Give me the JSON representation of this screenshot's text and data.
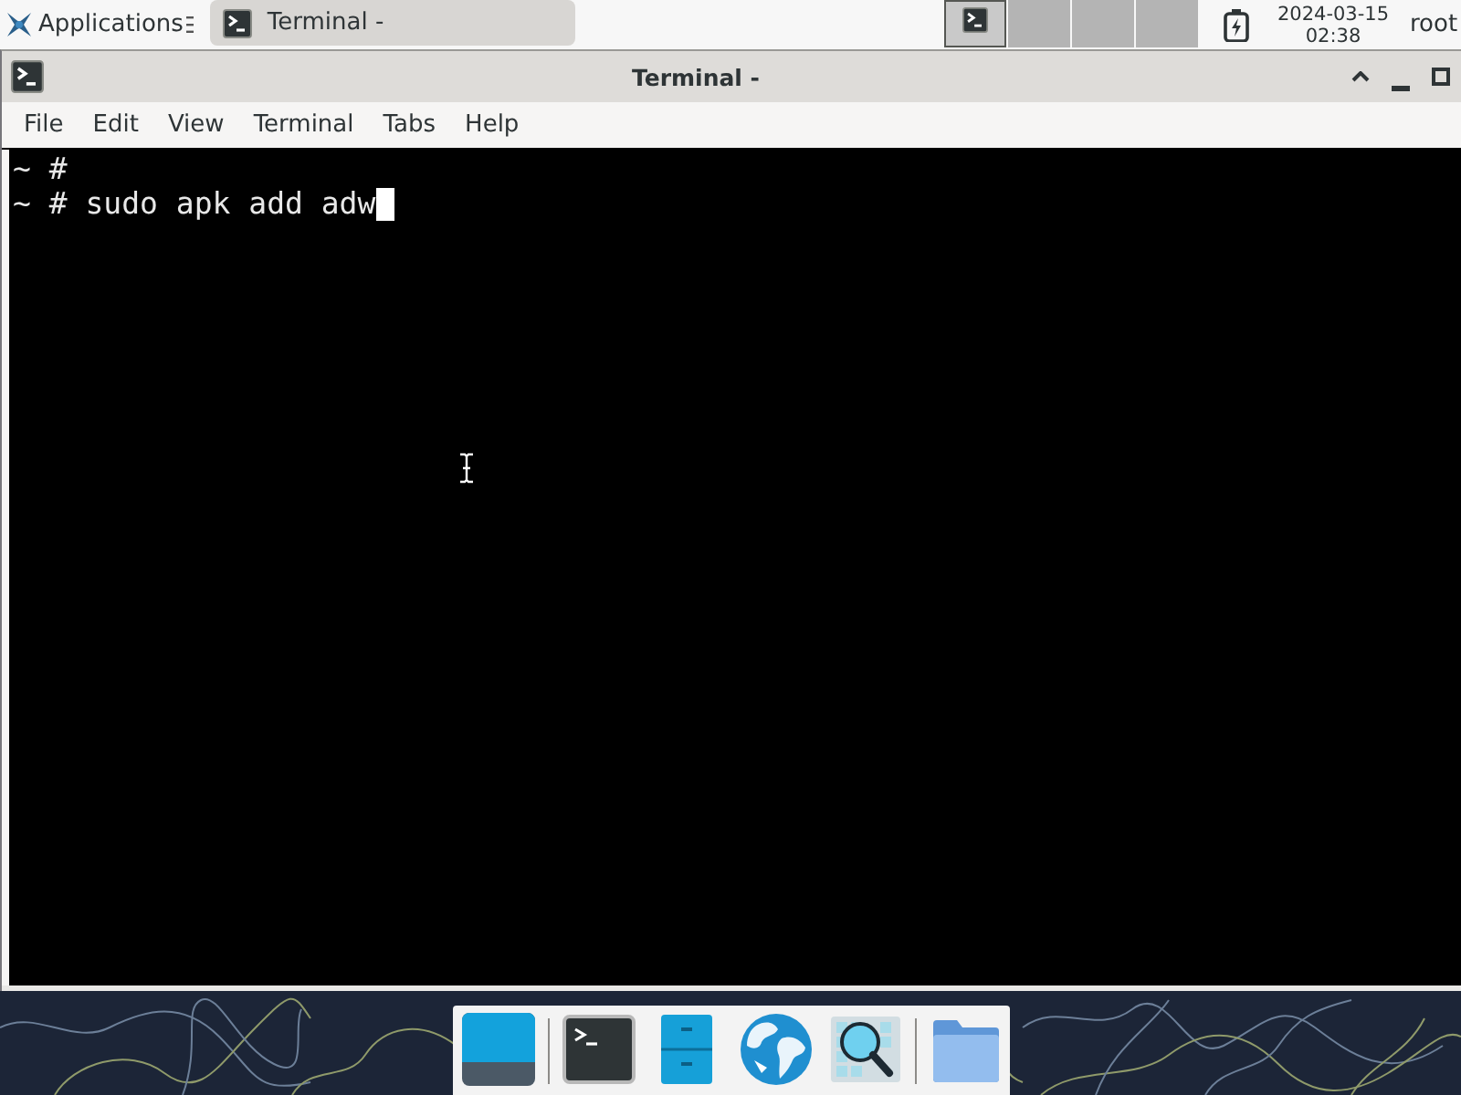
{
  "top_panel": {
    "applications_label": "Applications",
    "tasks": [
      {
        "label": "Terminal -",
        "selected": true
      }
    ],
    "workspaces": [
      {
        "selected": true,
        "has_window": true
      },
      {
        "selected": false,
        "has_window": false
      },
      {
        "selected": false,
        "has_window": false
      },
      {
        "selected": false,
        "has_window": false
      }
    ],
    "clock": {
      "date": "2024-03-15",
      "time": "02:38"
    },
    "user": "root"
  },
  "window": {
    "title": "Terminal -",
    "menu": [
      "File",
      "Edit",
      "View",
      "Terminal",
      "Tabs",
      "Help"
    ],
    "terminal": {
      "lines": [
        "~ #",
        "~ # sudo apk add adw"
      ],
      "cursor": true
    }
  },
  "dock": {
    "items": [
      {
        "kind": "desktop"
      },
      {
        "kind": "separator"
      },
      {
        "kind": "terminal"
      },
      {
        "kind": "cabinet"
      },
      {
        "kind": "globe"
      },
      {
        "kind": "search"
      },
      {
        "kind": "separator"
      },
      {
        "kind": "folder"
      }
    ]
  }
}
